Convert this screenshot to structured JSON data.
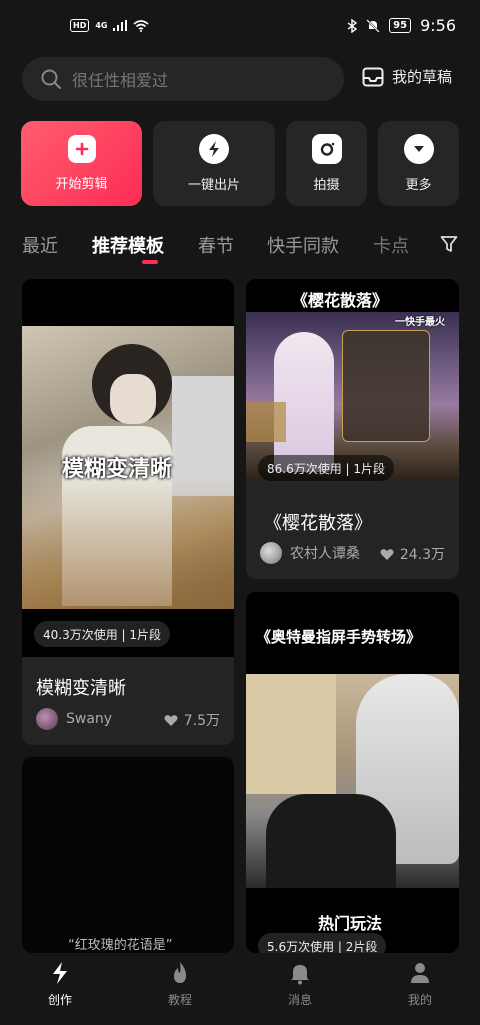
{
  "status_bar": {
    "hd": "HD",
    "network": "4G",
    "battery": "95",
    "time": "9:56"
  },
  "search": {
    "placeholder": "很任性相爱过"
  },
  "drafts": {
    "label": "我的草稿"
  },
  "actions": [
    {
      "label": "开始剪辑",
      "icon": "plus-icon"
    },
    {
      "label": "一键出片",
      "icon": "lightning-icon"
    },
    {
      "label": "拍摄",
      "icon": "camera-icon"
    },
    {
      "label": "更多",
      "icon": "chevron-down-icon"
    }
  ],
  "tabs": [
    "最近",
    "推荐模板",
    "春节",
    "快手同款",
    "卡点"
  ],
  "active_tab": "推荐模板",
  "cards": [
    {
      "overlay": "模糊变清晰",
      "usage": "40.3万次使用 | 1片段",
      "title": "模糊变清晰",
      "author": "Swany",
      "likes": "7.5万"
    },
    {
      "header": "《樱花散落》",
      "badge": "一快手最火",
      "usage": "86.6万次使用 | 1片段",
      "title": "《樱花散落》",
      "author": "农村人谭桑",
      "likes": "24.3万"
    },
    {
      "header": "《奥特曼指屏手势转场》",
      "overlay": "热门玩法",
      "usage": "5.6万次使用 | 2片段"
    },
    {
      "caption": "“红玫瑰的花语是”"
    }
  ],
  "bottom_nav": [
    {
      "label": "创作",
      "icon": "lightning-icon"
    },
    {
      "label": "教程",
      "icon": "flame-icon"
    },
    {
      "label": "消息",
      "icon": "bell-icon"
    },
    {
      "label": "我的",
      "icon": "person-icon"
    }
  ],
  "colors": {
    "accent": "#fe2c55",
    "background": "#161616",
    "card": "#242424"
  }
}
